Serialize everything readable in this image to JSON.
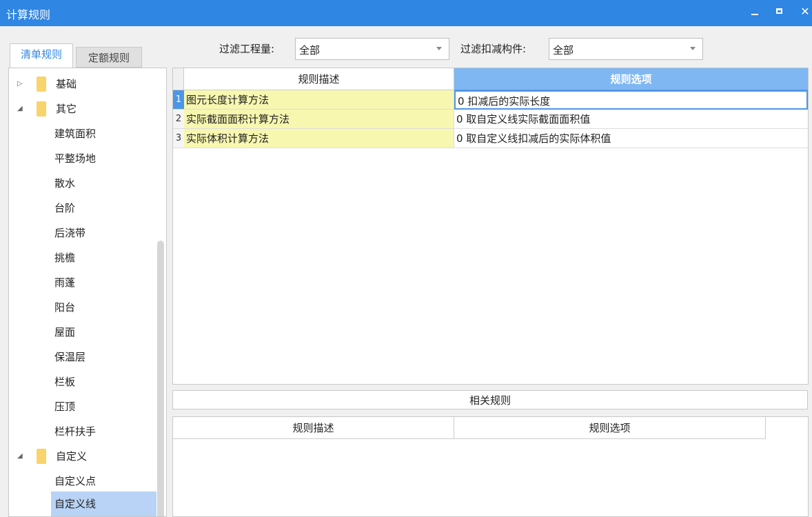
{
  "window": {
    "title": "计算规则"
  },
  "tabs": [
    {
      "label": "清单规则",
      "active": true
    },
    {
      "label": "定额规则",
      "active": false
    }
  ],
  "filters": {
    "quantity_label": "过滤工程量:",
    "quantity_value": "全部",
    "deduction_label": "过滤扣减构件:",
    "deduction_value": "全部"
  },
  "tree": {
    "groups": [
      {
        "label": "基础",
        "expanded": false
      },
      {
        "label": "其它",
        "expanded": true,
        "children": [
          "建筑面积",
          "平整场地",
          "散水",
          "台阶",
          "后浇带",
          "挑檐",
          "雨蓬",
          "阳台",
          "屋面",
          "保温层",
          "栏板",
          "压顶",
          "栏杆扶手"
        ]
      },
      {
        "label": "自定义",
        "expanded": true,
        "children": [
          "自定义点",
          "自定义线"
        ]
      }
    ],
    "selected": "自定义线"
  },
  "rules_grid": {
    "headers": {
      "desc": "规则描述",
      "option": "规则选项"
    },
    "rows": [
      {
        "num": "1",
        "desc": "图元长度计算方法",
        "option": "0 扣减后的实际长度"
      },
      {
        "num": "2",
        "desc": "实际截面面积计算方法",
        "option": "0   取自定义线实际截面面积值"
      },
      {
        "num": "3",
        "desc": "实际体积计算方法",
        "option": "0   取自定义线扣减后的实际体积值"
      }
    ]
  },
  "related": {
    "title": "相关规则",
    "headers": {
      "desc": "规则描述",
      "option": "规则选项"
    }
  },
  "colors": {
    "titlebar": "#2f86e3",
    "header_selected": "#7fb7f2",
    "desc_cell": "#f7f7b0",
    "tree_selected": "#b8d3f5"
  }
}
